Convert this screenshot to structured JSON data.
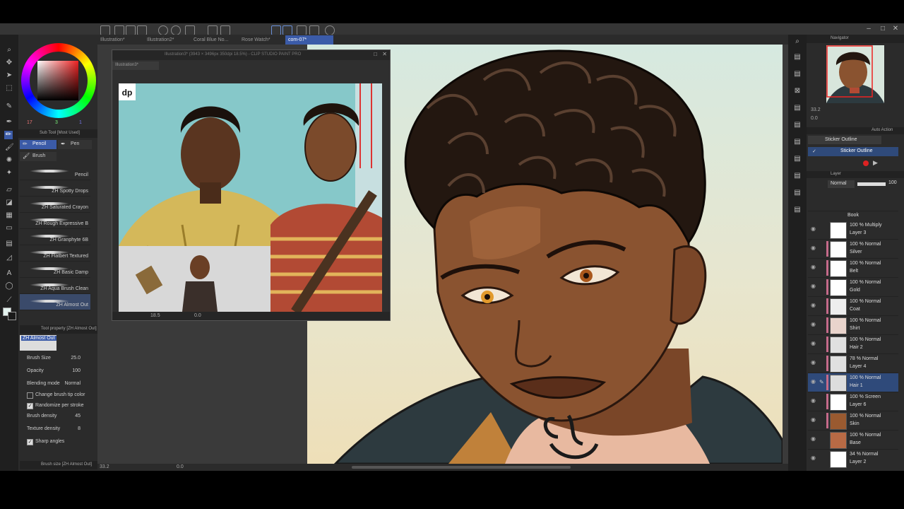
{
  "tabs": [
    "Illustration*",
    "Illustration2*",
    "Coral Blue No...",
    "Rose Watch*",
    "com-07*"
  ],
  "color_wheel": {
    "values": [
      "17",
      "3",
      "1"
    ]
  },
  "subtool": {
    "header": "Sub Tool [Most Used]",
    "tabs": [
      "Pencil",
      "Pen",
      "Brush"
    ],
    "brushes": [
      "Pencil",
      "ZH Spotty Drops",
      "ZH Saturated Crayon",
      "ZH Rough Expressive B",
      "ZH Granphyte 6B",
      "ZH Flatbert Textured",
      "ZH Basic Damp",
      "ZH Aqua Brush Clean",
      "ZH Almost Out"
    ]
  },
  "tool_property": {
    "header": "Tool property [ZH Almost Out]",
    "name": "ZH Almost Out",
    "rows": [
      {
        "label": "Brush Size",
        "value": "25.0"
      },
      {
        "label": "Opacity",
        "value": "100"
      },
      {
        "label": "Blending mode",
        "value": "Normal"
      },
      {
        "label": "Change brush tip color",
        "value": ""
      },
      {
        "label": "Randomize per stroke",
        "value": ""
      },
      {
        "label": "Brush density",
        "value": "45"
      },
      {
        "label": "Texture density",
        "value": "8"
      },
      {
        "label": "Sharp angles",
        "value": ""
      }
    ],
    "footer": "Brush size [ZH Almost Out]"
  },
  "ref_window": {
    "title": "Illustration3* (3943 × 3496px 350dpi 18.5%) - CLIP STUDIO PAINT PRO",
    "tab": "Illustration3*",
    "zoom": "18.5",
    "angle": "0.0"
  },
  "canvas_status": {
    "zoom": "33.2",
    "angle": "0.0"
  },
  "navigator": {
    "title": "Navigator",
    "zoom": "33.2",
    "angle": "0.0"
  },
  "auto_action": {
    "title": "Auto Action",
    "set": "Sticker Outline",
    "item": "Sticker Outline"
  },
  "layer_panel": {
    "title": "Layer",
    "blend": "Normal",
    "opacity": "100",
    "top_folder": "Book",
    "layers": [
      {
        "mode": "100 % Multiply",
        "name": "Layer 3"
      },
      {
        "mode": "100 % Normal",
        "name": "Silver"
      },
      {
        "mode": "100 % Normal",
        "name": "Belt"
      },
      {
        "mode": "100 % Normal",
        "name": "Gold"
      },
      {
        "mode": "100 % Normal",
        "name": "Coat"
      },
      {
        "mode": "100 % Normal",
        "name": "Shirt"
      },
      {
        "mode": "100 % Normal",
        "name": "Hair 2"
      },
      {
        "mode": "78 % Normal",
        "name": "Layer 4"
      },
      {
        "mode": "100 % Normal",
        "name": "Hair 1"
      },
      {
        "mode": "100 % Screen",
        "name": "Layer 6"
      },
      {
        "mode": "100 % Normal",
        "name": "Skin"
      },
      {
        "mode": "100 % Normal",
        "name": "Base"
      },
      {
        "mode": "34 % Normal",
        "name": "Layer 2"
      }
    ]
  },
  "colors": {
    "accent": "#3b5ba8",
    "selected_layer": "#2f4a7a",
    "ui_bg": "#2b2b2b"
  }
}
